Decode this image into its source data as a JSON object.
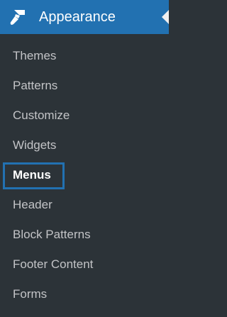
{
  "menu": {
    "title": "Appearance",
    "icon": "paintbrush-icon",
    "accent_color": "#2271b1",
    "background_color": "#2c3338",
    "text_color": "#c3c4c7",
    "current_item": "Menus",
    "items": [
      {
        "label": "Themes"
      },
      {
        "label": "Patterns"
      },
      {
        "label": "Customize"
      },
      {
        "label": "Widgets"
      },
      {
        "label": "Menus"
      },
      {
        "label": "Header"
      },
      {
        "label": "Block Patterns"
      },
      {
        "label": "Footer Content"
      },
      {
        "label": "Forms"
      }
    ]
  }
}
